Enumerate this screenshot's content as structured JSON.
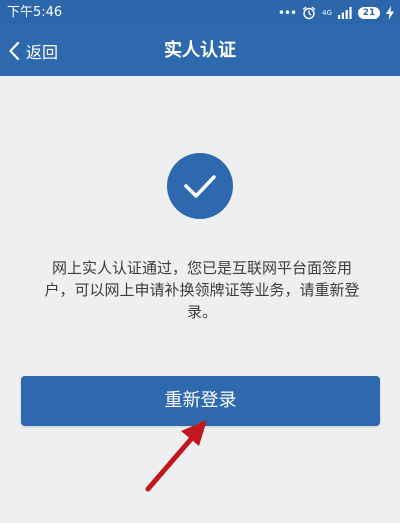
{
  "status_bar": {
    "time": "下午5:46",
    "network": "4G",
    "battery_level": "21",
    "icons": [
      "signal-dots-icon",
      "alarm-icon",
      "signal-icon",
      "battery-icon",
      "charging-icon"
    ]
  },
  "nav": {
    "back_label": "返回",
    "title": "实人认证"
  },
  "result": {
    "icon": "checkmark-icon",
    "message": "网上实人认证通过，您已是互联网平台面签用户，可以网上申请补换领牌证等业务，请重新登录。"
  },
  "actions": {
    "relogin_label": "重新登录"
  },
  "colors": {
    "primary": "#2f69ad",
    "background": "#eeeff1",
    "annotation_arrow": "#c0181d"
  }
}
